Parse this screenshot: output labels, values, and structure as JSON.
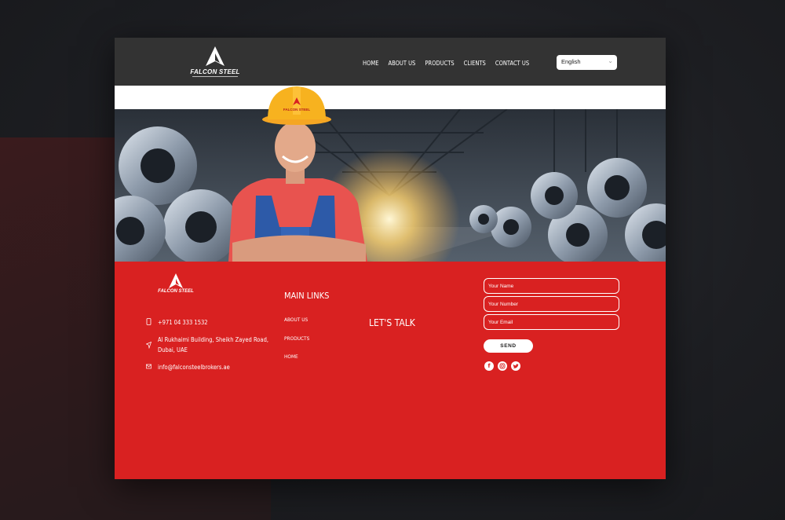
{
  "brand": {
    "name": "FALCON STEEL"
  },
  "nav": {
    "items": [
      "HOME",
      "ABOUT US",
      "PRODUCTS",
      "CLIENTS",
      "CONTACT US"
    ]
  },
  "language": {
    "selected": "English"
  },
  "hero": {
    "helmet_text": "FALCON STEEL"
  },
  "footer": {
    "phone": "+971 04 333 1532",
    "address_line1": "Al Rukhaimi Building, Sheikh Zayed Road,",
    "address_line2": "Dubai, UAE",
    "email": "info@falconsteelbrokers.ae",
    "main_links_title": "MAIN LINKS",
    "links": [
      "ABOUT US",
      "PRODUCTS",
      "HOME"
    ],
    "lets_talk": "LET'S TALK"
  },
  "form": {
    "name_placeholder": "Your Name",
    "number_placeholder": "Your Number",
    "email_placeholder": "Your Email",
    "send_label": "SEND"
  },
  "social": [
    "facebook-icon",
    "instagram-icon",
    "twitter-icon"
  ],
  "colors": {
    "header": "#333333",
    "footer": "#d92121",
    "accent": "#f5a623"
  }
}
